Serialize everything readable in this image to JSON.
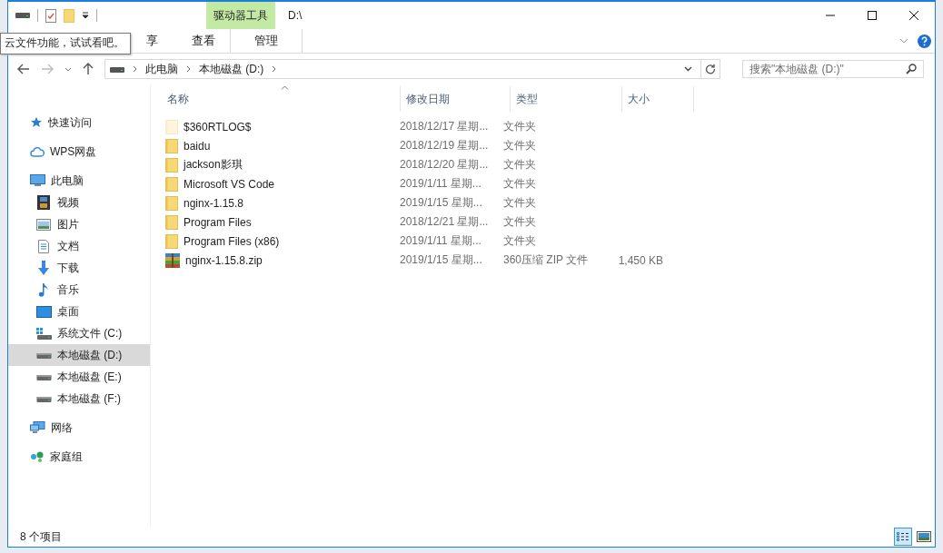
{
  "window": {
    "title": "D:\\",
    "context_group": "驱动器工具"
  },
  "ribbon_tabs": [
    {
      "label": "享",
      "selected": false
    },
    {
      "label": "查看",
      "selected": false
    },
    {
      "label": "管理",
      "selected": false
    }
  ],
  "tooltip": "云文件功能，试试看吧。",
  "address": {
    "crumbs": [
      "此电脑",
      "本地磁盘 (D:)"
    ]
  },
  "search": {
    "placeholder": "搜索\"本地磁盘 (D:)\""
  },
  "sidebar": {
    "items": [
      {
        "label": "快速访问",
        "selected": false
      },
      {
        "label": "WPS网盘",
        "selected": false
      },
      {
        "label": "此电脑",
        "selected": false,
        "children": [
          {
            "label": "视频",
            "selected": false
          },
          {
            "label": "图片",
            "selected": false
          },
          {
            "label": "文档",
            "selected": false
          },
          {
            "label": "下载",
            "selected": false
          },
          {
            "label": "音乐",
            "selected": false
          },
          {
            "label": "桌面",
            "selected": false
          },
          {
            "label": "系统文件 (C:)",
            "selected": false
          },
          {
            "label": "本地磁盘 (D:)",
            "selected": true
          },
          {
            "label": "本地磁盘 (E:)",
            "selected": false
          },
          {
            "label": "本地磁盘 (F:)",
            "selected": false
          }
        ]
      },
      {
        "label": "网络",
        "selected": false
      },
      {
        "label": "家庭组",
        "selected": false
      }
    ]
  },
  "table": {
    "columns": [
      {
        "label": "名称",
        "sorted": true
      },
      {
        "label": "修改日期",
        "sorted": false
      },
      {
        "label": "类型",
        "sorted": false
      },
      {
        "label": "大小",
        "sorted": false
      }
    ],
    "rows": [
      {
        "kind": "folder",
        "hidden": true,
        "name": "$360RTLOG$",
        "date": "2018/12/17 星期...",
        "type": "文件夹"
      },
      {
        "kind": "folder",
        "hidden": false,
        "name": "baidu",
        "date": "2018/12/19 星期...",
        "type": "文件夹"
      },
      {
        "kind": "folder",
        "hidden": false,
        "name": "jackson影琪",
        "date": "2018/12/20 星期...",
        "type": "文件夹"
      },
      {
        "kind": "folder",
        "hidden": false,
        "name": "Microsoft VS Code",
        "date": "2019/1/11 星期...",
        "type": "文件夹"
      },
      {
        "kind": "folder",
        "hidden": false,
        "name": "nginx-1.15.8",
        "date": "2019/1/15 星期...",
        "type": "文件夹"
      },
      {
        "kind": "folder",
        "hidden": false,
        "name": "Program Files",
        "date": "2018/12/21 星期...",
        "type": "文件夹"
      },
      {
        "kind": "folder",
        "hidden": false,
        "name": "Program Files (x86)",
        "date": "2019/1/11 星期...",
        "type": "文件夹"
      },
      {
        "kind": "zip",
        "hidden": false,
        "name": "nginx-1.15.8.zip",
        "date": "2019/1/15 星期...",
        "type": "360压缩 ZIP 文件",
        "size": "1,450 KB"
      }
    ]
  },
  "status_bar": {
    "count": "8 个项目",
    "views": [
      {
        "selected": true
      },
      {
        "selected": false
      }
    ]
  }
}
